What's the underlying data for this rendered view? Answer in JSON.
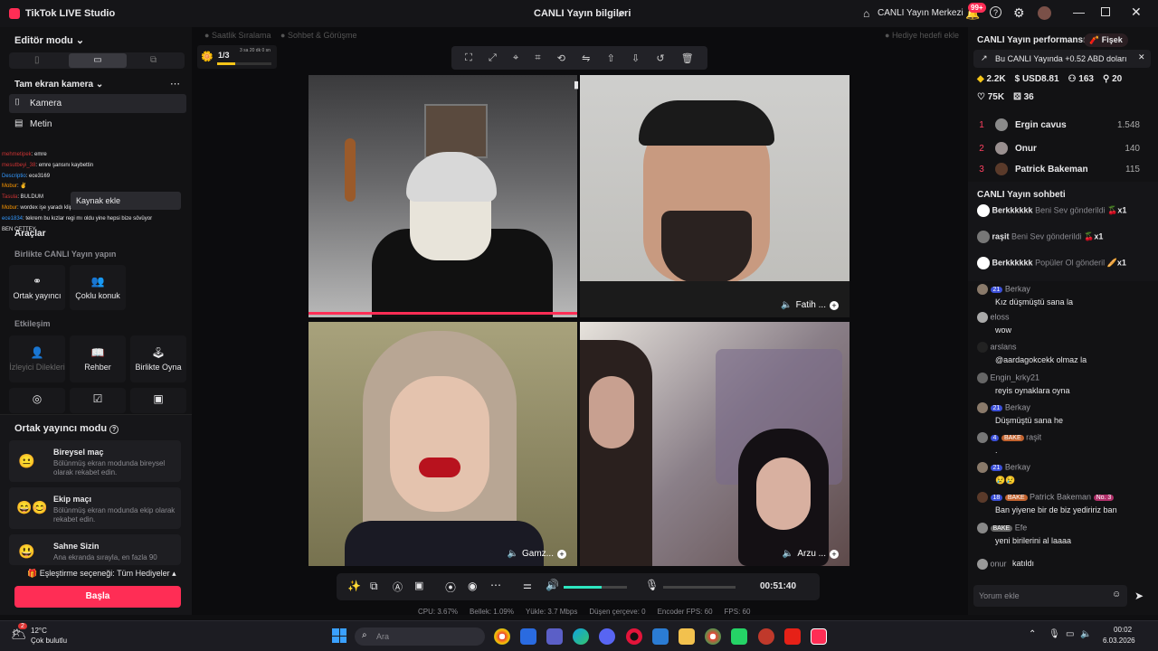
{
  "titlebar": {
    "app_name": "TikTok LIVE Studio",
    "center_title": "CANLI Yayın bilgileri",
    "live_center": "CANLI Yayın Merkezi",
    "notif_badge": "99+"
  },
  "left": {
    "editor_mode": "Editör modu",
    "camera_section": "Tam ekran kamera",
    "source_camera": "Kamera",
    "source_text": "Metin",
    "add_source": "Kaynak ekle",
    "tools_title": "Araçlar",
    "together_title": "Birlikte CANLI Yayın yapın",
    "cohost_btn": "Ortak yayıncı",
    "multi_guest_btn": "Çoklu konuk",
    "interaction_title": "Etkileşim",
    "viewer_wishes": "İzleyici Dilekleri",
    "guide": "Rehber",
    "play_together": "Birlikte Oyna",
    "cohost_mode_title": "Ortak yayıncı modu",
    "modes": [
      {
        "title": "Bireysel maç",
        "desc": "Bölünmüş ekran modunda bireysel olarak rekabet edin."
      },
      {
        "title": "Ekip maçı",
        "desc": "Bölünmüş ekran modunda ekip olarak rekabet edin."
      },
      {
        "title": "Sahne Sizin",
        "desc": "Ana ekranda sırayla, en fazla 90"
      }
    ],
    "match_option": "Eşleştirme seçeneği: Tüm Hediyeler",
    "start_button": "Başla",
    "chat_overlay": [
      {
        "user": "mehmetipek",
        "text": ": emre"
      },
      {
        "user": "mesutbeyi_38",
        "text": ": emre şansını kaybettin"
      },
      {
        "user": "Descriptio",
        "text": ": ece3169"
      },
      {
        "user": "Mobur",
        "text": ":"
      },
      {
        "user": "Tasula",
        "text": ": BULDUM"
      },
      {
        "user": "Mobur",
        "text": ": wordex işe yaradı klipler dedi"
      },
      {
        "user": "ece1834",
        "text": ": tekrem bu kızlar regi mı oldu yine hepsi bize sövüyor"
      },
      {
        "user": "",
        "text": "BEN ÇETTEY"
      }
    ]
  },
  "stage": {
    "top_tabs": [
      "Saatlik Sıralama",
      "Sohbet & Görüşme",
      "Hediye hedefi ekle"
    ],
    "goal_progress": "1/3",
    "goal_sub": "3 sa 20 dk 0 sn",
    "goal_fraction": 0.33,
    "video_labels": [
      "Fatih ...",
      "Gamz...",
      "Arzu ..."
    ],
    "timer": "00:51:40",
    "volume_level": 0.6,
    "stats": [
      "CPU: 3.67%",
      "Bellek: 1.09%",
      "Yükle: 3.7 Mbps",
      "Düşen çerçeve: 0",
      "Encoder FPS: 60",
      "FPS: 60"
    ]
  },
  "right": {
    "perf_title": "CANLI Yayın performansı",
    "firework": "Fişek",
    "earnings_banner": "Bu CANLI Yayında +0.52 ABD doları",
    "stats": [
      {
        "icon": "diamond-icon",
        "value": "2.2K"
      },
      {
        "icon": "dollar-icon",
        "value": "USD8.81"
      },
      {
        "icon": "viewers-icon",
        "value": "163"
      },
      {
        "icon": "new-follower-icon",
        "value": "20"
      },
      {
        "icon": "heart-icon",
        "value": "75K"
      },
      {
        "icon": "gift-icon",
        "value": "36"
      }
    ],
    "ranking": [
      {
        "rank": "1",
        "name": "Ergin cavus",
        "score": "1.548"
      },
      {
        "rank": "2",
        "name": "Onur",
        "score": "140"
      },
      {
        "rank": "3",
        "name": "Patrick Bakeman",
        "score": "115"
      }
    ],
    "chat_title": "CANLI Yayın sohbeti",
    "gifts": [
      {
        "user": "Berkkkkkk",
        "action": "Beni Sev gönderildi",
        "count": "x1"
      },
      {
        "user": "raşit",
        "action": "Beni Sev gönderildi",
        "count": "x1"
      },
      {
        "user": "Berkkkkkk",
        "action": "Popüler Ol gönderil",
        "count": "x1"
      }
    ],
    "messages": [
      {
        "name": "Berkay",
        "text": "Kız düşmüştü sana la"
      },
      {
        "name": "eloss",
        "text": "wow"
      },
      {
        "name": "arslans",
        "text": "@aardagokcekk olmaz la"
      },
      {
        "name": "Engin_krky21",
        "text": "reyis oynaklara oyna"
      },
      {
        "name": "Berkay",
        "level": "21",
        "text": "Düşmüştü sana he"
      },
      {
        "name": "raşit",
        "level": "4",
        "team": "BAKE",
        "text": "."
      },
      {
        "name": "Berkay",
        "level": "21",
        "text": "😢😢"
      },
      {
        "name": "Patrick Bakeman",
        "level": "18",
        "team": "BAKE",
        "rank": "No. 3",
        "text": "Ban yiyene bir de biz yediririz ban"
      },
      {
        "name": "Efe",
        "team": "BAKE",
        "text": "yeni birilerini al laaaa"
      },
      {
        "name": "onur",
        "text": "katıldı"
      }
    ],
    "comment_placeholder": "Yorum ekle"
  },
  "taskbar": {
    "weather_temp": "12°C",
    "weather_desc": "Çok bulutlu",
    "weather_badge": "2",
    "search_placeholder": "Ara",
    "time": "00:02",
    "date": "6.03.2026"
  }
}
